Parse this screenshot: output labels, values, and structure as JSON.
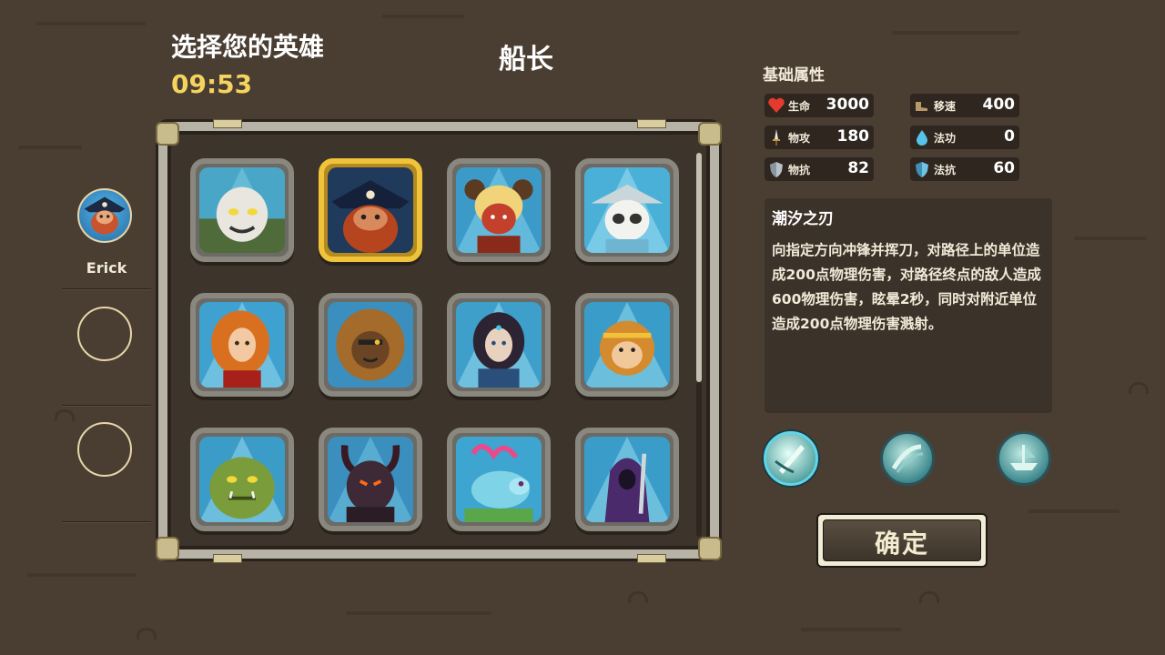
{
  "header": {
    "title": "选择您的英雄",
    "timer": "09:53",
    "selected_hero_name": "船长"
  },
  "party_slots": [
    {
      "label": "Erick",
      "filled": true
    },
    {
      "label": "",
      "filled": false
    },
    {
      "label": "",
      "filled": false
    }
  ],
  "heroes": [
    {
      "icon": "white-beast-hero-icon",
      "selected": false
    },
    {
      "icon": "pirate-captain-hero-icon",
      "selected": true
    },
    {
      "icon": "horned-girl-hero-icon",
      "selected": false
    },
    {
      "icon": "panda-monk-hero-icon",
      "selected": false
    },
    {
      "icon": "fire-mage-hero-icon",
      "selected": false
    },
    {
      "icon": "lion-warrior-hero-icon",
      "selected": false
    },
    {
      "icon": "sea-priestess-hero-icon",
      "selected": false
    },
    {
      "icon": "monkey-king-hero-icon",
      "selected": false
    },
    {
      "icon": "ogre-hero-icon",
      "selected": false
    },
    {
      "icon": "demon-lord-hero-icon",
      "selected": false
    },
    {
      "icon": "dragon-hero-icon",
      "selected": false
    },
    {
      "icon": "dark-knight-hero-icon",
      "selected": false
    }
  ],
  "attributes": {
    "title": "基础属性",
    "stats": [
      {
        "icon": "heart-icon",
        "label": "生命",
        "value": "3000"
      },
      {
        "icon": "boots-icon",
        "label": "移速",
        "value": "400"
      },
      {
        "icon": "sword-icon",
        "label": "物攻",
        "value": "180"
      },
      {
        "icon": "water-drop-icon",
        "label": "法功",
        "value": "0"
      },
      {
        "icon": "shield-icon",
        "label": "物抗",
        "value": "82"
      },
      {
        "icon": "magic-shield-icon",
        "label": "法抗",
        "value": "60"
      }
    ]
  },
  "skill": {
    "name": "潮汐之刃",
    "description": "向指定方向冲锋并挥刀，对路径上的单位造成200点物理伤害，对路径终点的敌人造成600物理伤害，眩晕2秒，同时对附近单位造成200点物理伤害溅射。"
  },
  "skill_icons": [
    {
      "icon": "tide-blade-skill-icon",
      "active": true
    },
    {
      "icon": "water-slash-skill-icon",
      "active": false
    },
    {
      "icon": "ship-summon-skill-icon",
      "active": false
    }
  ],
  "confirm_button": {
    "label": "确定"
  },
  "colors": {
    "background": "#4a3e33",
    "timer": "#f4d35e",
    "selected_border": "#f0c43a",
    "frame": "#b7b3a6",
    "skill_ring": "#5fd4ea"
  }
}
